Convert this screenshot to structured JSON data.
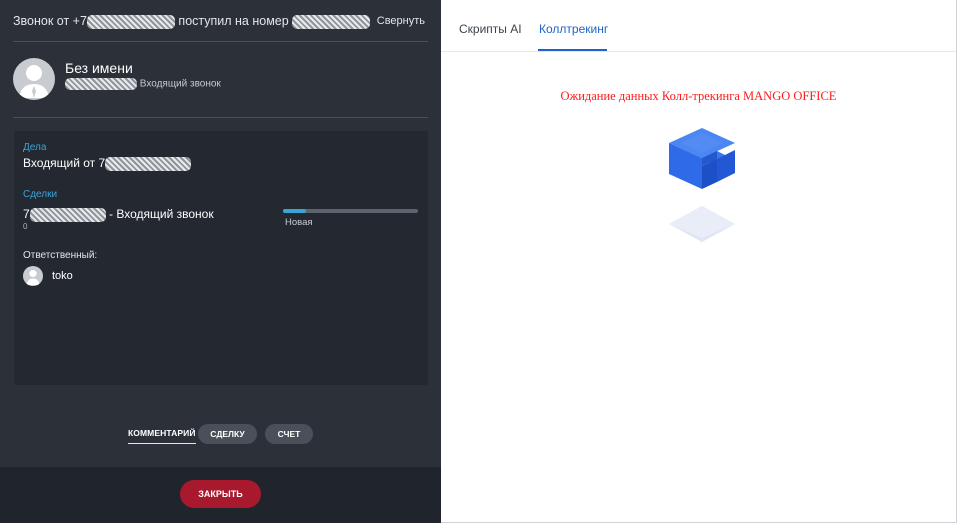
{
  "call": {
    "title_prefix": "Звонок от +7",
    "title_middle": "поступил на номер",
    "collapse_label": "Свернуть"
  },
  "contact": {
    "name": "Без имени",
    "subtitle": "Входящий звонок"
  },
  "tasks": {
    "label": "Дела",
    "item_prefix": "Входящий от 7"
  },
  "deals": {
    "label": "Сделки",
    "item_prefix": "7",
    "item_suffix": "- Входящий звонок",
    "item_sub": "0",
    "stage": "Новая",
    "stage_progress": 0.17
  },
  "responsible": {
    "label": "Ответственный:",
    "name": "toko"
  },
  "actions": {
    "comment": "КОММЕНТАРИЙ",
    "deal": "СДЕЛКУ",
    "invoice": "СЧЕТ"
  },
  "footer": {
    "close_label": "ЗАКРЫТЬ"
  },
  "right_tabs": [
    {
      "label": "Скрипты AI",
      "active": false
    },
    {
      "label": "Коллтрекинг",
      "active": true
    }
  ],
  "calltracking": {
    "status_text": "Ожидание данных Колл-трекинга MANGO OFFICE"
  },
  "icons": {
    "avatar": "user-silhouette-icon",
    "logo": "mango-cube-icon"
  },
  "colors": {
    "accent_blue": "#3ba4d6",
    "tab_active": "#1f63c6",
    "close_button": "#a8192e",
    "status_text": "#ff1a1a",
    "logo_blue": "#2f6be8"
  }
}
